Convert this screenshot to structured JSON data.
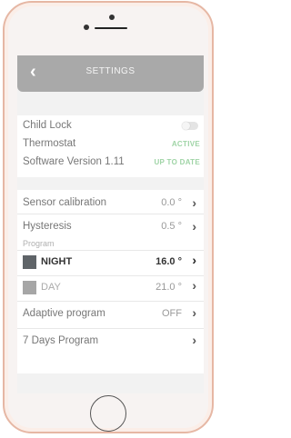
{
  "header": {
    "back_glyph": "‹",
    "title": "SETTINGS"
  },
  "status_section": {
    "child_lock": {
      "label": "Child Lock",
      "toggle": "off"
    },
    "thermostat": {
      "label": "Thermostat",
      "status": "ACTIVE"
    },
    "software": {
      "label": "Software Version 1.11",
      "status": "UP TO DATE"
    }
  },
  "calibration_section": {
    "sensor": {
      "label": "Sensor calibration",
      "value": "0.0 °"
    },
    "hysteresis": {
      "label": "Hysteresis",
      "value": "0.5 °"
    }
  },
  "program_section": {
    "heading": "Program",
    "night": {
      "label": "NIGHT",
      "value": "16.0 °",
      "color": "#5f6468"
    },
    "day": {
      "label": "DAY",
      "value": "21.0 °",
      "color": "#a6a6a6"
    },
    "adaptive": {
      "label": "Adaptive program",
      "value": "OFF"
    },
    "seven_days": {
      "label": "7 Days Program"
    }
  },
  "icons": {
    "chevron": "chevron-right-icon",
    "back": "chevron-left-icon"
  },
  "colors": {
    "status_green": "#9fd4a6",
    "header_bg": "#a9a9a9",
    "phone_frame": "#e6b7a4"
  }
}
